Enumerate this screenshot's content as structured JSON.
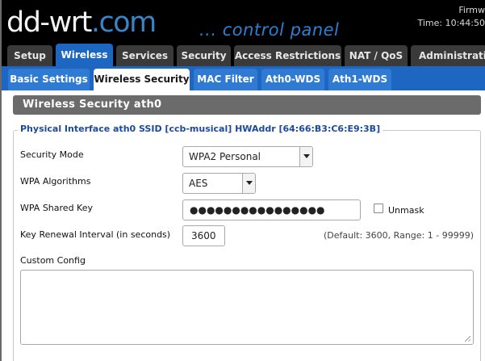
{
  "header": {
    "logo_main": "dd-wrt",
    "logo_suffix": ".com",
    "subtitle": "... control panel",
    "firmware": "Firmw",
    "time": "Time: 10:44:50"
  },
  "main_tabs": [
    {
      "label": "Setup",
      "active": false
    },
    {
      "label": "Wireless",
      "active": true
    },
    {
      "label": "Services",
      "active": false
    },
    {
      "label": "Security",
      "active": false
    },
    {
      "label": "Access Restrictions",
      "active": false
    },
    {
      "label": "NAT / QoS",
      "active": false
    },
    {
      "label": "Administration",
      "active": false
    }
  ],
  "sub_tabs": [
    {
      "label": "Basic Settings",
      "active": false
    },
    {
      "label": "Wireless Security",
      "active": true
    },
    {
      "label": "MAC Filter",
      "active": false
    },
    {
      "label": "Ath0-WDS",
      "active": false
    },
    {
      "label": "Ath1-WDS",
      "active": false
    }
  ],
  "section": {
    "title": "Wireless Security ath0",
    "legend": "Physical Interface ath0 SSID [ccb-musical] HWAddr [64:66:B3:C6:E9:3B]"
  },
  "form": {
    "security_mode": {
      "label": "Security Mode",
      "value": "WPA2 Personal"
    },
    "wpa_algorithms": {
      "label": "WPA Algorithms",
      "value": "AES"
    },
    "wpa_shared_key": {
      "label": "WPA Shared Key",
      "value": "●●●●●●●●●●●●●●●●",
      "unmask_label": "Unmask",
      "unmask_checked": false
    },
    "key_renewal": {
      "label": "Key Renewal Interval (in seconds)",
      "value": "3600",
      "hint": "(Default: 3600, Range: 1 - 99999)"
    },
    "custom_config": {
      "label": "Custom Config",
      "value": ""
    }
  },
  "colors": {
    "accent": "#1d67c3",
    "header_bg": "#000000",
    "legend_text": "#1c4aa0",
    "section_header": "#6b6b6b"
  }
}
